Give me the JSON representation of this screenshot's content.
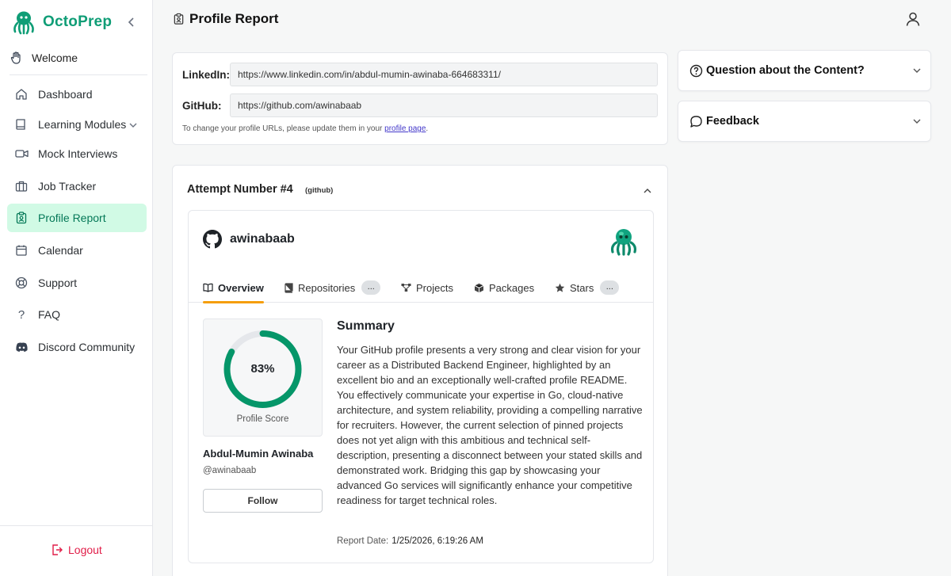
{
  "brand": {
    "name": "OctoPrep"
  },
  "sidebar": {
    "welcome": "Welcome",
    "items": [
      {
        "label": "Dashboard",
        "icon": "home-icon"
      },
      {
        "label": "Learning Modules",
        "icon": "book-icon"
      },
      {
        "label": "Mock Interviews",
        "icon": "video-icon"
      },
      {
        "label": "Job Tracker",
        "icon": "briefcase-icon"
      },
      {
        "label": "Profile Report",
        "icon": "clipboard-user-icon",
        "active": true
      },
      {
        "label": "Calendar",
        "icon": "calendar-icon"
      },
      {
        "label": "Support",
        "icon": "lifebuoy-icon"
      },
      {
        "label": "FAQ",
        "icon": "question-mark-icon"
      },
      {
        "label": "Discord Community",
        "icon": "discord-icon"
      }
    ],
    "logout": "Logout"
  },
  "header": {
    "title": "Profile Report"
  },
  "profile_urls": {
    "linkedin_label": "LinkedIn:",
    "linkedin_value": "https://www.linkedin.com/in/abdul-mumin-awinaba-664683311/",
    "github_label": "GitHub:",
    "github_value": "https://github.com/awinabaab",
    "note_prefix": "To change your profile URLs, please update them in your ",
    "note_link": "profile page",
    "note_suffix": "."
  },
  "right_panel": {
    "question": "Question about the Content?",
    "feedback": "Feedback"
  },
  "attempt": {
    "title": "Attempt Number #4",
    "source": "(github)",
    "username": "awinabaab",
    "tabs": {
      "overview": "Overview",
      "repositories": "Repositories",
      "repositories_count": "...",
      "projects": "Projects",
      "packages": "Packages",
      "stars": "Stars",
      "stars_count": "..."
    },
    "score": {
      "value": "83%",
      "fraction": 0.83,
      "label": "Profile Score",
      "color": "#059669"
    },
    "full_name": "Abdul-Mumin Awinaba",
    "handle": "@awinabaab",
    "follow_label": "Follow",
    "summary_title": "Summary",
    "summary_text": "Your GitHub profile presents a very strong and clear vision for your career as a Distributed Backend Engineer, highlighted by an excellent bio and an exceptionally well-crafted profile README. You effectively communicate your expertise in Go, cloud-native architecture, and system reliability, providing a compelling narrative for recruiters. However, the current selection of pinned projects does not yet align with this ambitious and technical self-description, presenting a disconnect between your stated skills and demonstrated work. Bridging this gap by showcasing your advanced Go services will significantly enhance your competitive readiness for target technical roles.",
    "report_date_label": "Report Date:",
    "report_date_value": "1/25/2026, 6:19:26 AM"
  }
}
